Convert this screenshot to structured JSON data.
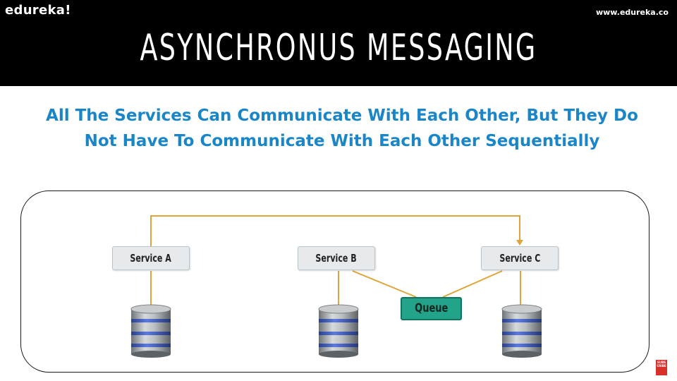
{
  "brand": "edureka!",
  "website": "www.edureka.co",
  "title": "ASYNCHRONUS MESSAGING",
  "subtitle_line1": "All The Services Can Communicate With Each Other, But They Do",
  "subtitle_line2": "Not Have To Communicate With Each Other Sequentially",
  "services": [
    "Service A",
    "Service B",
    "Service C"
  ],
  "queue": "Queue",
  "subscribe": "SUBS CRIBE",
  "colors": {
    "header": "#000000",
    "subtitle": "#1a86c8",
    "connector": "#e0a43a",
    "queue_fill": "#23a389",
    "service_fill": "#e6eaed",
    "db_band": "#3d5ec4"
  },
  "icons": [
    "database-icon",
    "arrow-down-icon",
    "subscribe-icon"
  ]
}
